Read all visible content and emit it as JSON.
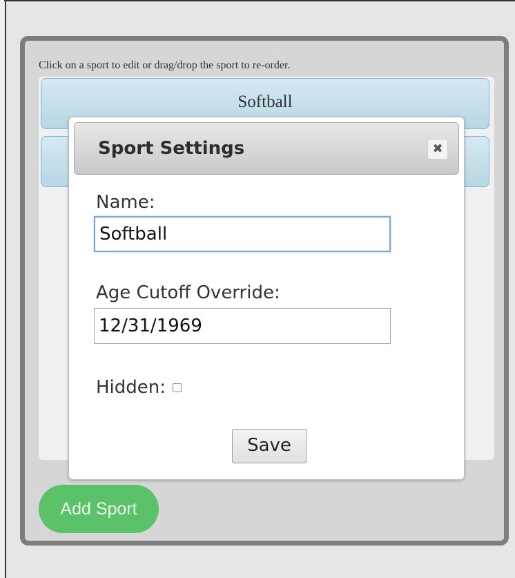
{
  "panel": {
    "instructions": "Click on a sport to edit or drag/drop the sport to re-order.",
    "sports": [
      {
        "label": "Softball"
      },
      {
        "label": ""
      }
    ],
    "add_button_label": "Add Sport"
  },
  "dialog": {
    "title": "Sport Settings",
    "close_glyph": "✖",
    "name_label": "Name:",
    "name_value": "Softball",
    "age_label": "Age Cutoff Override:",
    "age_value": "12/31/1969",
    "hidden_label": "Hidden:",
    "hidden_checked": false,
    "save_label": "Save"
  },
  "colors": {
    "sport_item": "#c8e2ec",
    "add_button": "#5cc26a",
    "panel_border": "#7d7d7d"
  }
}
